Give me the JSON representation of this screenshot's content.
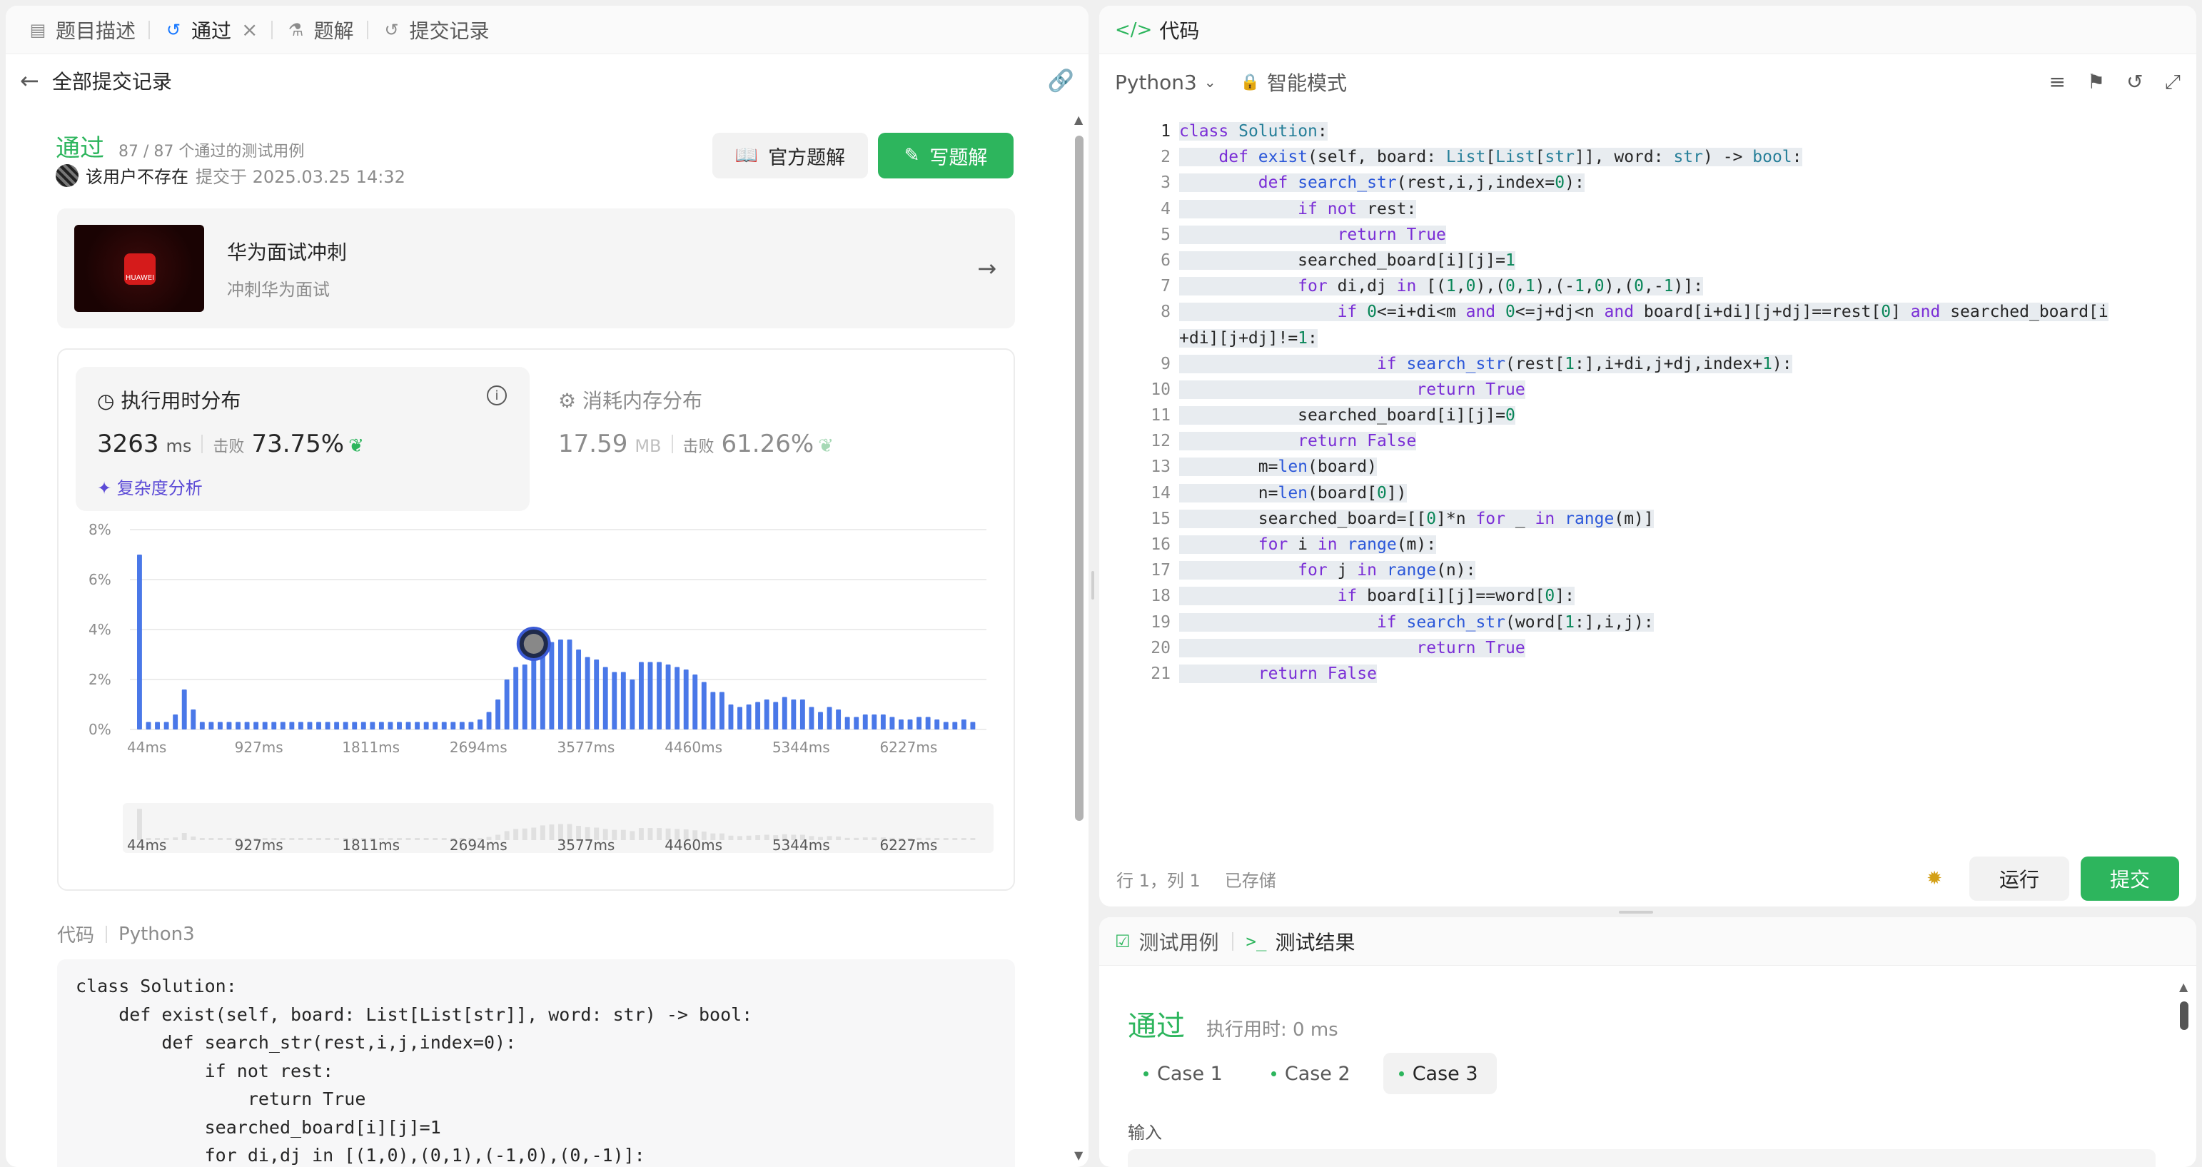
{
  "left_tabs": [
    {
      "label": "题目描述",
      "icon": "document-icon"
    },
    {
      "label": "通过",
      "icon": "history-icon"
    },
    {
      "label": "题解",
      "icon": "flask-icon"
    },
    {
      "label": "提交记录",
      "icon": "history-icon"
    }
  ],
  "subbar": {
    "back_label": "全部提交记录"
  },
  "submission": {
    "status": "通过",
    "tests": "87 / 87 个通过的测试用例",
    "user": "该用户不存在",
    "submitted": "提交于 2025.03.25 14:32",
    "official_btn": "官方题解",
    "write_btn": "写题解"
  },
  "promo": {
    "title": "华为面试冲刺",
    "subtitle": "冲刺华为面试",
    "logo_text": "HUAWEI"
  },
  "runtime": {
    "title": "执行用时分布",
    "value": "3263",
    "unit": "ms",
    "beat_label": "击败",
    "beat": "73.75%",
    "link": "复杂度分析"
  },
  "memory": {
    "title": "消耗内存分布",
    "value": "17.59",
    "unit": "MB",
    "beat_label": "击败",
    "beat": "61.26%"
  },
  "chart_data": {
    "type": "bar",
    "title": "",
    "xlabel": "",
    "ylabel": "",
    "y_ticks": [
      "8%",
      "6%",
      "4%",
      "2%",
      "0%"
    ],
    "x_ticks": [
      "44ms",
      "927ms",
      "1811ms",
      "2694ms",
      "3577ms",
      "4460ms",
      "5344ms",
      "6227ms"
    ],
    "ylim": [
      0,
      8
    ],
    "x_range_ms": [
      44,
      6900
    ],
    "values": [
      7.0,
      0.3,
      0.3,
      0.3,
      0.6,
      1.6,
      0.8,
      0.3,
      0.3,
      0.3,
      0.3,
      0.3,
      0.3,
      0.3,
      0.3,
      0.3,
      0.3,
      0.3,
      0.3,
      0.3,
      0.3,
      0.3,
      0.3,
      0.3,
      0.3,
      0.3,
      0.3,
      0.3,
      0.3,
      0.3,
      0.3,
      0.3,
      0.3,
      0.3,
      0.3,
      0.3,
      0.3,
      0.3,
      0.4,
      0.7,
      1.2,
      2.0,
      2.5,
      2.6,
      2.8,
      3.3,
      3.5,
      3.6,
      3.6,
      3.2,
      2.9,
      2.8,
      2.5,
      2.3,
      2.3,
      2.0,
      2.7,
      2.7,
      2.7,
      2.6,
      2.5,
      2.4,
      2.2,
      1.9,
      1.5,
      1.5,
      1.0,
      0.9,
      1.0,
      1.1,
      1.2,
      1.1,
      1.3,
      1.2,
      1.2,
      0.9,
      0.7,
      0.9,
      0.8,
      0.5,
      0.5,
      0.6,
      0.6,
      0.6,
      0.5,
      0.4,
      0.4,
      0.5,
      0.5,
      0.4,
      0.3,
      0.3,
      0.4,
      0.3
    ],
    "highlight_index": 44,
    "bar_color": "#4a78e8",
    "grid": true
  },
  "code_section": {
    "label": "代码",
    "lang": "Python3"
  },
  "code_preview": [
    "class Solution:",
    "    def exist(self, board: List[List[str]], word: str) -> bool:",
    "        def search_str(rest,i,j,index=0):",
    "            if not rest:",
    "                return True",
    "            searched_board[i][j]=1",
    "            for di,dj in [(1,0),(0,1),(-1,0),(0,-1)]:",
    "                if 0<=i+di<m and 0<=j+dj<n and board[i+di][j+dj]==rest[0] and sea"
  ],
  "editor": {
    "title": "代码",
    "language": "Python3",
    "mode": "智能模式",
    "lines": [
      "class Solution:",
      "    def exist(self, board: List[List[str]], word: str) -> bool:",
      "        def search_str(rest,i,j,index=0):",
      "            if not rest:",
      "                return True",
      "            searched_board[i][j]=1",
      "            for di,dj in [(1,0),(0,1),(-1,0),(0,-1)]:",
      "                if 0<=i+di<m and 0<=j+dj<n and board[i+di][j+dj]==rest[0] and searched_board[i",
      "+di][j+dj]!=1:",
      "                    if search_str(rest[1:],i+di,j+dj,index+1):",
      "                        return True",
      "            searched_board[i][j]=0",
      "            return False",
      "        m=len(board)",
      "        n=len(board[0])",
      "        searched_board=[[0]*n for _ in range(m)]",
      "        for i in range(m):",
      "            for j in range(n):",
      "                if board[i][j]==word[0]:",
      "                    if search_str(word[1:],i,j):",
      "                        return True",
      "        return False"
    ],
    "line_numbers": [
      "1",
      "2",
      "3",
      "4",
      "5",
      "6",
      "7",
      "8",
      "",
      "9",
      "10",
      "11",
      "12",
      "13",
      "14",
      "15",
      "16",
      "17",
      "18",
      "19",
      "20",
      "21"
    ],
    "cursor": "行 1，列 1",
    "saved": "已存储",
    "run_btn": "运行",
    "submit_btn": "提交"
  },
  "results": {
    "tab_cases": "测试用例",
    "tab_result": "测试结果",
    "status": "通过",
    "time": "执行用时: 0 ms",
    "cases": [
      "Case 1",
      "Case 2",
      "Case 3"
    ],
    "active_case": 2,
    "input_label": "输入"
  },
  "colors": {
    "accent_green": "#2db55d",
    "bar_blue": "#4a78e8"
  }
}
